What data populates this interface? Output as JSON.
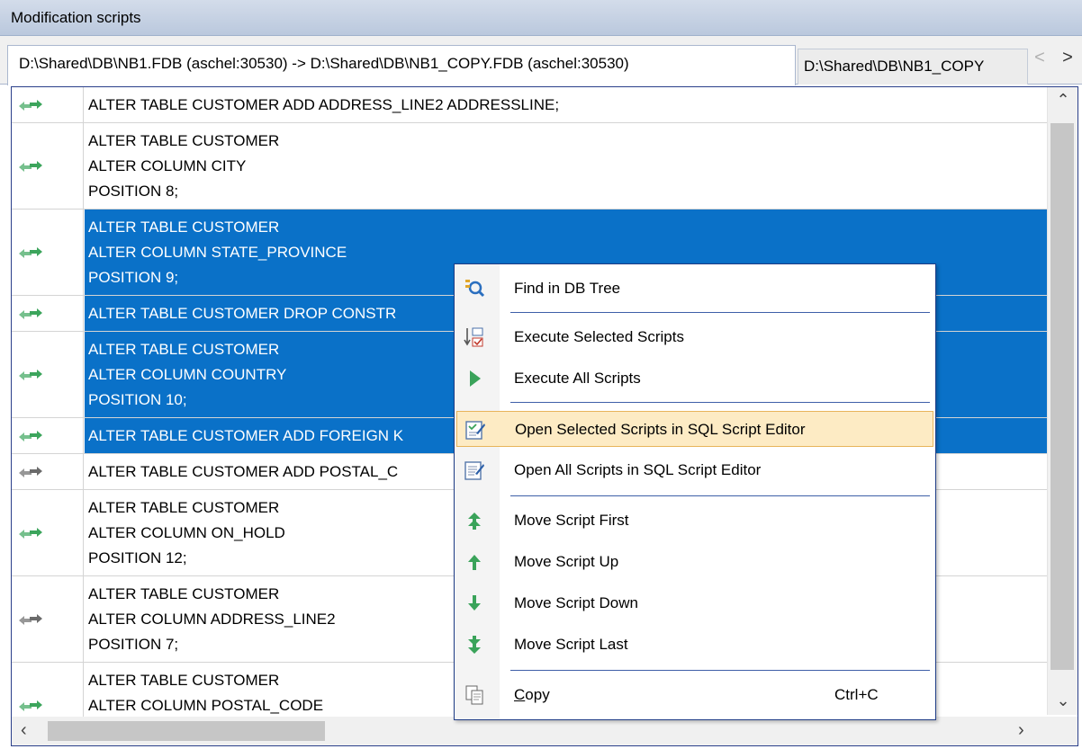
{
  "panel": {
    "title": "Modification scripts"
  },
  "tabs": {
    "active": "D:\\Shared\\DB\\NB1.FDB (aschel:30530) -> D:\\Shared\\DB\\NB1_COPY.FDB (aschel:30530)",
    "inactive": "D:\\Shared\\DB\\NB1_COPY",
    "scroll_left": "<",
    "scroll_right": ">"
  },
  "scripts": [
    {
      "lines": [
        "ALTER TABLE CUSTOMER ADD ADDRESS_LINE2 ADDRESSLINE;"
      ],
      "selected": false,
      "icon": "sync-arrows-icon"
    },
    {
      "lines": [
        "ALTER TABLE CUSTOMER",
        "ALTER COLUMN CITY",
        "POSITION 8;"
      ],
      "selected": false,
      "icon": "sync-arrows-icon"
    },
    {
      "lines": [
        "ALTER TABLE CUSTOMER",
        "ALTER COLUMN STATE_PROVINCE",
        "POSITION 9;"
      ],
      "selected": true,
      "icon": "sync-arrows-icon"
    },
    {
      "lines": [
        "ALTER TABLE CUSTOMER DROP CONSTR"
      ],
      "selected": true,
      "icon": "sync-arrows-icon"
    },
    {
      "lines": [
        "ALTER TABLE CUSTOMER",
        "ALTER COLUMN COUNTRY",
        "POSITION 10;"
      ],
      "selected": true,
      "icon": "sync-arrows-icon"
    },
    {
      "lines": [
        "ALTER TABLE CUSTOMER ADD FOREIGN K"
      ],
      "selected": true,
      "icon": "sync-arrows-icon"
    },
    {
      "lines": [
        "ALTER TABLE CUSTOMER ADD POSTAL_C"
      ],
      "selected": false,
      "icon": "sync-arrows-icon"
    },
    {
      "lines": [
        "ALTER TABLE CUSTOMER",
        "ALTER COLUMN ON_HOLD",
        "POSITION 12;"
      ],
      "selected": false,
      "icon": "sync-arrows-icon"
    },
    {
      "lines": [
        "ALTER TABLE CUSTOMER",
        "ALTER COLUMN ADDRESS_LINE2",
        "POSITION 7;"
      ],
      "selected": false,
      "icon": "sync-arrows-icon"
    },
    {
      "lines": [
        "ALTER TABLE CUSTOMER",
        "ALTER COLUMN POSTAL_CODE"
      ],
      "selected": false,
      "icon": "sync-arrows-icon"
    }
  ],
  "context_menu": {
    "items": [
      {
        "label": "Find in DB Tree",
        "icon": "find-in-tree-icon"
      },
      {
        "label": "Execute Selected Scripts",
        "icon": "execute-selected-icon"
      },
      {
        "label": "Execute All Scripts",
        "icon": "play-icon"
      },
      {
        "label": "Open Selected Scripts in SQL Script Editor",
        "icon": "open-selected-editor-icon",
        "highlighted": true
      },
      {
        "label": "Open All Scripts in SQL Script Editor",
        "icon": "open-all-editor-icon"
      },
      {
        "label": "Move Script First",
        "icon": "move-first-icon"
      },
      {
        "label": "Move Script Up",
        "icon": "move-up-icon"
      },
      {
        "label": "Move Script Down",
        "icon": "move-down-icon"
      },
      {
        "label": "Move Script Last",
        "icon": "move-last-icon"
      },
      {
        "label": "Copy",
        "icon": "copy-icon",
        "shortcut": "Ctrl+C"
      }
    ]
  },
  "colors": {
    "selection": "#0a71c8",
    "menu_highlight": "#fdebc4",
    "border": "#2a3f8a",
    "arrow_icon": "#3ca55c"
  }
}
